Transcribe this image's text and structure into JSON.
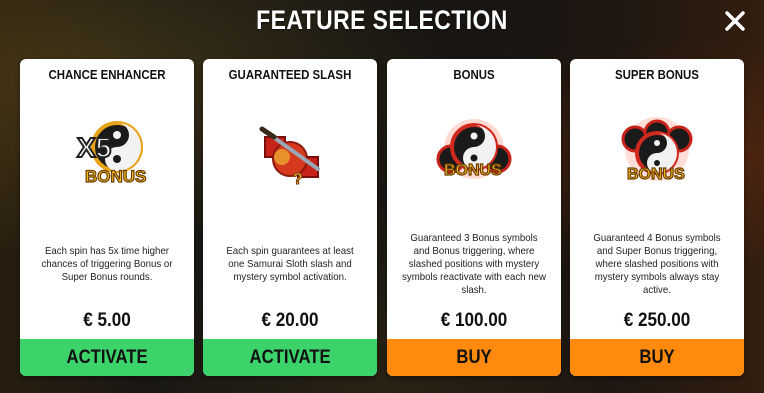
{
  "header": {
    "title": "FEATURE SELECTION",
    "close_icon": "close-icon"
  },
  "colors": {
    "activate": "#3dd36b",
    "buy": "#ff8a0d",
    "card": "#ffffff"
  },
  "cards": [
    {
      "name": "CHANCE ENHANCER",
      "icon": "x5-bonus-icon",
      "art_text_multiplier": "X5",
      "art_text_bonus": "BONUS",
      "description": "Each spin has 5x time higher chances of triggering Bonus or Super Bonus rounds.",
      "price": "€ 5.00",
      "button": "ACTIVATE"
    },
    {
      "name": "GUARANTEED SLASH",
      "icon": "slash-mystery-icon",
      "art_text_mystery": "?",
      "description": "Each spin guarantees at least one Samurai Sloth slash and mystery symbol activation.",
      "price": "€ 20.00",
      "button": "ACTIVATE"
    },
    {
      "name": "BONUS",
      "icon": "yin-yang-bonus-icon",
      "art_text_bonus": "BONUS",
      "description": "Guaranteed 3 Bonus symbols and Bonus triggering, where slashed positions with mystery symbols reactivate with each new slash.",
      "price": "€ 100.00",
      "button": "BUY"
    },
    {
      "name": "SUPER BONUS",
      "icon": "super-bonus-icon",
      "art_text_bonus": "BONUS",
      "description": "Guaranteed 4 Bonus symbols and Super Bonus triggering, where slashed positions with mystery symbols always stay active.",
      "price": "€ 250.00",
      "button": "BUY"
    }
  ]
}
